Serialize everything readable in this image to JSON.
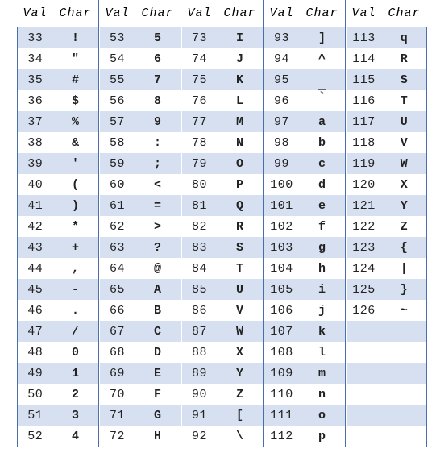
{
  "table": {
    "headers": {
      "val": "Val",
      "char": "Char"
    },
    "column_count": 5,
    "row_count": 20,
    "colors": {
      "stripe": "#d6e0f0",
      "background": "#ffffff",
      "border": "#4a6fa8",
      "value_text": "#3d3d3d",
      "char_text": "#000000"
    },
    "columns": [
      {
        "index": 0,
        "rows": [
          {
            "val": "33",
            "char": "!"
          },
          {
            "val": "34",
            "char": "\""
          },
          {
            "val": "35",
            "char": "#"
          },
          {
            "val": "36",
            "char": "$"
          },
          {
            "val": "37",
            "char": "%"
          },
          {
            "val": "38",
            "char": "&"
          },
          {
            "val": "39",
            "char": "'"
          },
          {
            "val": "40",
            "char": "("
          },
          {
            "val": "41",
            "char": ")"
          },
          {
            "val": "42",
            "char": "*"
          },
          {
            "val": "43",
            "char": "+"
          },
          {
            "val": "44",
            "char": ","
          },
          {
            "val": "45",
            "char": "-"
          },
          {
            "val": "46",
            "char": "."
          },
          {
            "val": "47",
            "char": "/"
          },
          {
            "val": "48",
            "char": "0"
          },
          {
            "val": "49",
            "char": "1"
          },
          {
            "val": "50",
            "char": "2"
          },
          {
            "val": "51",
            "char": "3"
          },
          {
            "val": "52",
            "char": "4"
          }
        ]
      },
      {
        "index": 1,
        "rows": [
          {
            "val": "53",
            "char": "5"
          },
          {
            "val": "54",
            "char": "6"
          },
          {
            "val": "55",
            "char": "7"
          },
          {
            "val": "56",
            "char": "8"
          },
          {
            "val": "57",
            "char": "9"
          },
          {
            "val": "58",
            "char": ":"
          },
          {
            "val": "59",
            "char": ";"
          },
          {
            "val": "60",
            "char": "<"
          },
          {
            "val": "61",
            "char": "="
          },
          {
            "val": "62",
            "char": ">"
          },
          {
            "val": "63",
            "char": "?"
          },
          {
            "val": "64",
            "char": "@"
          },
          {
            "val": "65",
            "char": "A"
          },
          {
            "val": "66",
            "char": "B"
          },
          {
            "val": "67",
            "char": "C"
          },
          {
            "val": "68",
            "char": "D"
          },
          {
            "val": "69",
            "char": "E"
          },
          {
            "val": "70",
            "char": "F"
          },
          {
            "val": "71",
            "char": "G"
          },
          {
            "val": "72",
            "char": "H"
          }
        ]
      },
      {
        "index": 2,
        "rows": [
          {
            "val": "73",
            "char": "I"
          },
          {
            "val": "74",
            "char": "J"
          },
          {
            "val": "75",
            "char": "K"
          },
          {
            "val": "76",
            "char": "L"
          },
          {
            "val": "77",
            "char": "M"
          },
          {
            "val": "78",
            "char": "N"
          },
          {
            "val": "79",
            "char": "O"
          },
          {
            "val": "80",
            "char": "P"
          },
          {
            "val": "81",
            "char": "Q"
          },
          {
            "val": "82",
            "char": "R"
          },
          {
            "val": "83",
            "char": "S"
          },
          {
            "val": "84",
            "char": "T"
          },
          {
            "val": "85",
            "char": "U"
          },
          {
            "val": "86",
            "char": "V"
          },
          {
            "val": "87",
            "char": "W"
          },
          {
            "val": "88",
            "char": "X"
          },
          {
            "val": "89",
            "char": "Y"
          },
          {
            "val": "90",
            "char": "Z"
          },
          {
            "val": "91",
            "char": "["
          },
          {
            "val": "92",
            "char": "\\"
          }
        ]
      },
      {
        "index": 3,
        "rows": [
          {
            "val": "93",
            "char": "]"
          },
          {
            "val": "94",
            "char": "^"
          },
          {
            "val": "95",
            "char": "_",
            "glyph_style": "low"
          },
          {
            "val": "96",
            "char": "`",
            "glyph_style": "backtick"
          },
          {
            "val": "97",
            "char": "a"
          },
          {
            "val": "98",
            "char": "b"
          },
          {
            "val": "99",
            "char": "c"
          },
          {
            "val": "100",
            "char": "d"
          },
          {
            "val": "101",
            "char": "e"
          },
          {
            "val": "102",
            "char": "f"
          },
          {
            "val": "103",
            "char": "g"
          },
          {
            "val": "104",
            "char": "h"
          },
          {
            "val": "105",
            "char": "i"
          },
          {
            "val": "106",
            "char": "j"
          },
          {
            "val": "107",
            "char": "k"
          },
          {
            "val": "108",
            "char": "l"
          },
          {
            "val": "109",
            "char": "m"
          },
          {
            "val": "110",
            "char": "n"
          },
          {
            "val": "111",
            "char": "o"
          },
          {
            "val": "112",
            "char": "p"
          }
        ]
      },
      {
        "index": 4,
        "rows": [
          {
            "val": "113",
            "char": "q"
          },
          {
            "val": "114",
            "char": "R"
          },
          {
            "val": "115",
            "char": "S"
          },
          {
            "val": "116",
            "char": "T"
          },
          {
            "val": "117",
            "char": "U"
          },
          {
            "val": "118",
            "char": "V"
          },
          {
            "val": "119",
            "char": "W"
          },
          {
            "val": "120",
            "char": "X"
          },
          {
            "val": "121",
            "char": "Y"
          },
          {
            "val": "122",
            "char": "Z"
          },
          {
            "val": "123",
            "char": "{"
          },
          {
            "val": "124",
            "char": "|"
          },
          {
            "val": "125",
            "char": "}"
          },
          {
            "val": "126",
            "char": "~"
          },
          {
            "val": "",
            "char": ""
          },
          {
            "val": "",
            "char": ""
          },
          {
            "val": "",
            "char": ""
          },
          {
            "val": "",
            "char": ""
          },
          {
            "val": "",
            "char": ""
          },
          {
            "val": "",
            "char": ""
          }
        ]
      }
    ]
  }
}
